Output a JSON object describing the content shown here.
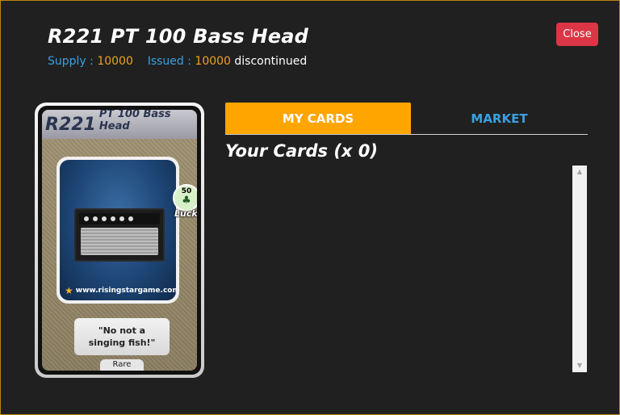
{
  "header": {
    "title": "R221 PT 100 Bass Head",
    "supply_label": "Supply :",
    "supply_value": "10000",
    "issued_label": "Issued :",
    "issued_value": "10000",
    "status": "discontinued",
    "close_label": "Close"
  },
  "card": {
    "code": "R221",
    "name": "PT 100 Bass Head",
    "luck_value": "50",
    "luck_label": "Luck",
    "site": "www.risingstargame.com",
    "quote": "\"No not a singing fish!\"",
    "rarity": "Rare"
  },
  "tabs": [
    {
      "label": "MY CARDS",
      "active": true
    },
    {
      "label": "MARKET",
      "active": false
    }
  ],
  "main": {
    "section_title": "Your Cards (x 0)"
  },
  "colors": {
    "accent": "#ffa500",
    "link_blue": "#3ba0e0",
    "number_orange": "#f0a020",
    "close_red": "#dc3545"
  }
}
